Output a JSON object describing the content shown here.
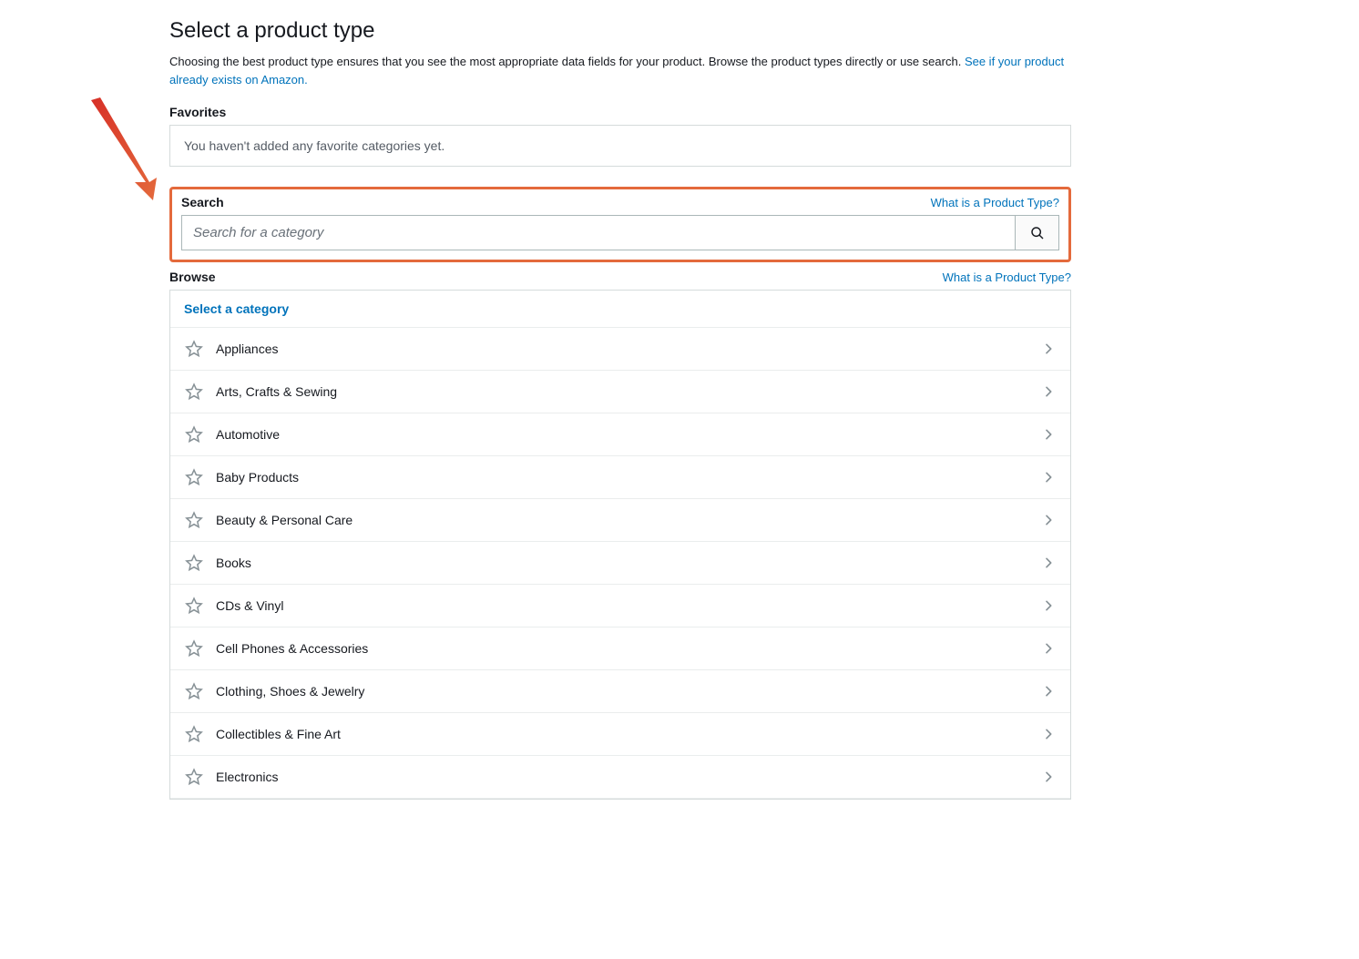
{
  "page": {
    "title": "Select a product type",
    "intro_text": "Choosing the best product type ensures that you see the most appropriate data fields for your product. Browse the product types directly or use search. ",
    "intro_link": "See if your product already exists on Amazon."
  },
  "favorites": {
    "heading": "Favorites",
    "empty_msg": "You haven't added any favorite categories yet."
  },
  "search": {
    "heading": "Search",
    "help_link": "What is a Product Type?",
    "placeholder": "Search for a category"
  },
  "browse": {
    "heading": "Browse",
    "help_link": "What is a Product Type?",
    "select_label": "Select a category",
    "categories": [
      {
        "label": "Appliances"
      },
      {
        "label": "Arts, Crafts & Sewing"
      },
      {
        "label": "Automotive"
      },
      {
        "label": "Baby Products"
      },
      {
        "label": "Beauty & Personal Care"
      },
      {
        "label": "Books"
      },
      {
        "label": "CDs & Vinyl"
      },
      {
        "label": "Cell Phones & Accessories"
      },
      {
        "label": "Clothing, Shoes & Jewelry"
      },
      {
        "label": "Collectibles & Fine Art"
      },
      {
        "label": "Electronics"
      }
    ]
  }
}
